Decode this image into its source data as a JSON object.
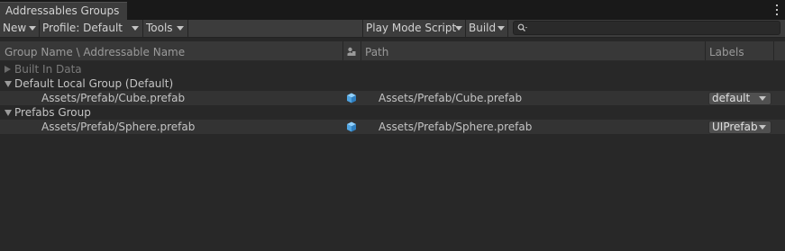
{
  "window": {
    "tab_title": "Addressables Groups",
    "menu_icon": "kebab-menu-icon"
  },
  "toolbar": {
    "new_label": "New",
    "profile_label": "Profile: Default",
    "tools_label": "Tools",
    "play_mode_label": "Play Mode Script",
    "build_label": "Build",
    "search_value": "",
    "search_icon": "search-icon"
  },
  "columns": {
    "name": "Group Name \\ Addressable Name",
    "type_icon": "asset-type-icon",
    "path": "Path",
    "labels": "Labels"
  },
  "tree": {
    "groups": [
      {
        "name": "Built In Data",
        "expanded": false,
        "entries": []
      },
      {
        "name": "Default Local Group (Default)",
        "expanded": true,
        "entries": [
          {
            "name": "Assets/Prefab/Cube.prefab",
            "icon": "prefab-cube-icon",
            "path": "Assets/Prefab/Cube.prefab",
            "label": "default"
          }
        ]
      },
      {
        "name": "Prefabs Group",
        "expanded": true,
        "entries": [
          {
            "name": "Assets/Prefab/Sphere.prefab",
            "icon": "prefab-cube-icon",
            "path": "Assets/Prefab/Sphere.prefab",
            "label": "UIPrefab"
          }
        ]
      }
    ]
  },
  "colors": {
    "background": "#282828",
    "toolbar": "#3c3c3c",
    "prefab_icon": "#4fa3e0"
  }
}
